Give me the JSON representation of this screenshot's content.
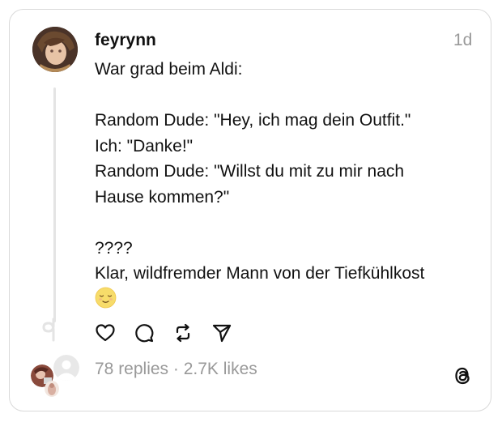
{
  "post": {
    "username": "feyrynn",
    "timestamp": "1d",
    "lines": [
      "War grad beim Aldi:",
      "",
      "Random Dude: \"Hey, ich mag dein Outfit.\"",
      "Ich: \"Danke!\"",
      "Random Dude: \"Willst du mit zu mir nach",
      "Hause kommen?\"",
      "",
      "????",
      "Klar, wildfremder Mann von der Tiefkühlkost"
    ],
    "emoji": "relieved-face-emoji"
  },
  "actions": {
    "icons": [
      "heart-icon",
      "comment-icon",
      "repost-icon",
      "share-icon"
    ]
  },
  "stats": {
    "replies": "78 replies",
    "separator": " · ",
    "likes": "2.7K likes"
  },
  "colors": {
    "text": "#111111",
    "muted": "#999999",
    "border": "#d9d9d9",
    "thread_line": "#e4e4e4",
    "emoji_fill": "#f7dc6a"
  }
}
